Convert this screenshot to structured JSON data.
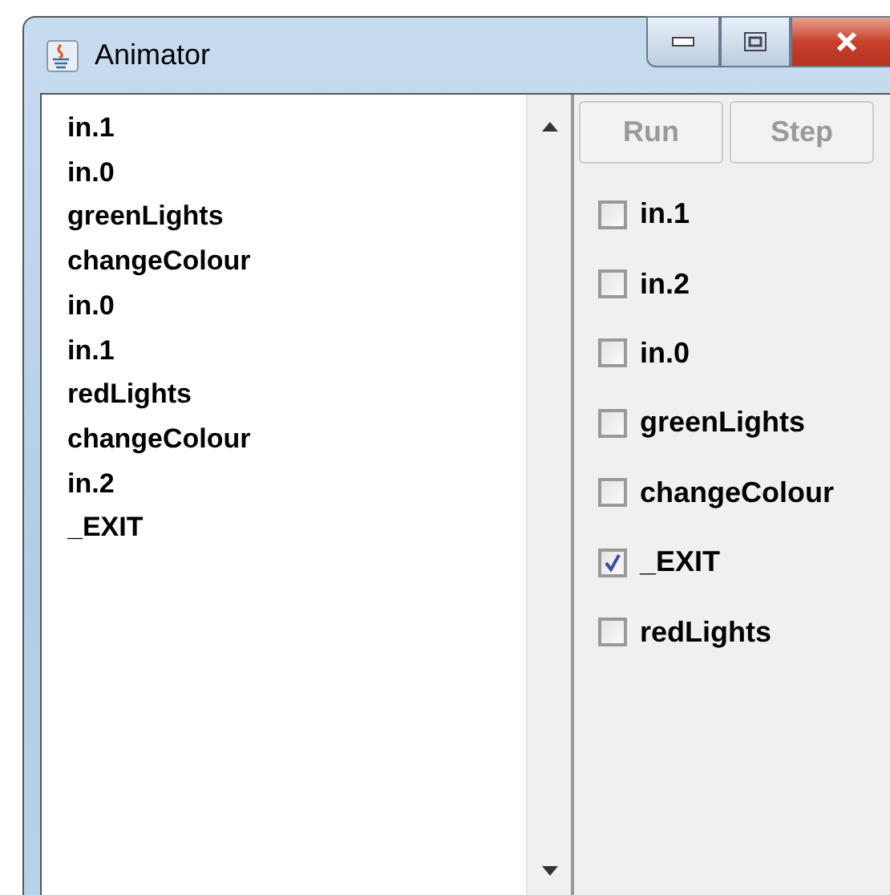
{
  "window": {
    "title": "Animator"
  },
  "trace": [
    "in.1",
    "in.0",
    "greenLights",
    "changeColour",
    "in.0",
    "in.1",
    "redLights",
    "changeColour",
    "in.2",
    "_EXIT"
  ],
  "buttons": [
    {
      "label": "Run",
      "disabled": true
    },
    {
      "label": "Step",
      "disabled": true
    }
  ],
  "actions": [
    {
      "label": "in.1",
      "checked": false
    },
    {
      "label": "in.2",
      "checked": false
    },
    {
      "label": "in.0",
      "checked": false
    },
    {
      "label": "greenLights",
      "checked": false
    },
    {
      "label": "changeColour",
      "checked": false
    },
    {
      "label": "_EXIT",
      "checked": true
    },
    {
      "label": "redLights",
      "checked": false
    }
  ]
}
